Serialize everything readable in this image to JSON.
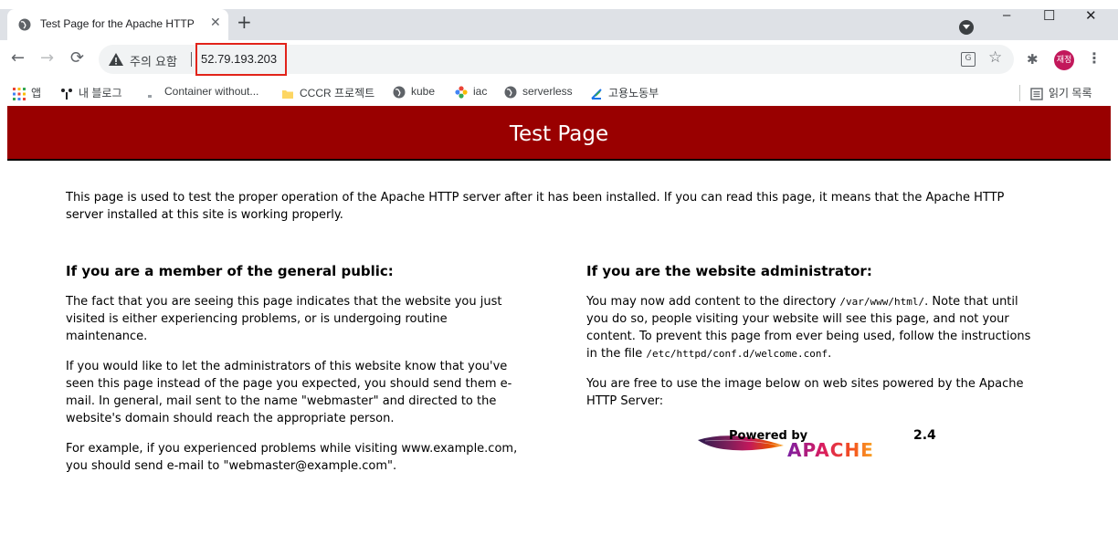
{
  "browser": {
    "tab": {
      "title": "Test Page for the Apache HTTP",
      "close": "✕"
    },
    "new_tab": "+",
    "window": {
      "minimize": "–",
      "maximize": "☐",
      "close": "✕"
    },
    "nav": {
      "back": "←",
      "forward": "→",
      "reload": "⟳"
    },
    "omnibox": {
      "security_label": "주의 요함",
      "url": "52.79.193.203",
      "translate": "G",
      "bookmark_star": "☆"
    },
    "extensions": "✱",
    "profile": "재정",
    "menu": "⋮",
    "bookmarks": [
      {
        "label": "앱",
        "icon": "apps-grid-icon"
      },
      {
        "label": "내 블로그",
        "icon": "blog-icon"
      },
      {
        "label": "Container without...",
        "icon": "page-icon"
      },
      {
        "label": "CCCR 프로젝트",
        "icon": "folder-icon"
      },
      {
        "label": "kube",
        "icon": "globe-icon"
      },
      {
        "label": "iac",
        "icon": "flower-icon"
      },
      {
        "label": "serverless",
        "icon": "globe-icon"
      },
      {
        "label": "고용노동부",
        "icon": "ministry-icon"
      }
    ],
    "reading_list": "읽기 목록"
  },
  "page": {
    "title": "Test Page",
    "intro": "This page is used to test the proper operation of the Apache HTTP server after it has been installed. If you can read this page, it means that the Apache HTTP server installed at this site is working properly.",
    "public": {
      "heading": "If you are a member of the general public:",
      "p1": "The fact that you are seeing this page indicates that the website you just visited is either experiencing problems, or is undergoing routine maintenance.",
      "p2": "If you would like to let the administrators of this website know that you've seen this page instead of the page you expected, you should send them e-mail. In general, mail sent to the name \"webmaster\" and directed to the website's domain should reach the appropriate person.",
      "p3": "For example, if you experienced problems while visiting www.example.com, you should send e-mail to \"webmaster@example.com\"."
    },
    "admin": {
      "heading": "If you are the website administrator:",
      "p1_a": "You may now add content to the directory ",
      "p1_code1": "/var/www/html/",
      "p1_b": ". Note that until you do so, people visiting your website will see this page, and not your content. To prevent this page from ever being used, follow the instructions in the file ",
      "p1_code2": "/etc/httpd/conf.d/welcome.conf",
      "p1_c": ".",
      "p2": "You are free to use the image below on web sites powered by the Apache HTTP Server:"
    },
    "logo": {
      "powered_by": "Powered by",
      "version": "2.4",
      "name": "APACHE"
    }
  },
  "colors": {
    "banner": "#990000",
    "url_highlight": "#e2231a"
  }
}
